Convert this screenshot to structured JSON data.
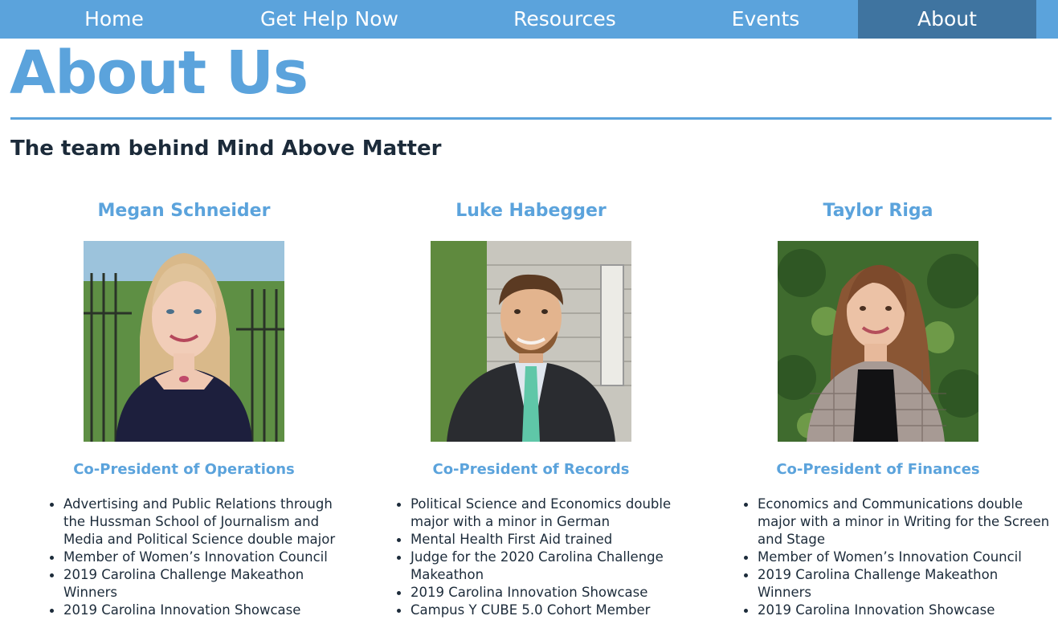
{
  "nav": {
    "items": [
      {
        "label": "Home"
      },
      {
        "label": "Get Help Now"
      },
      {
        "label": "Resources"
      },
      {
        "label": "Events"
      },
      {
        "label": "About"
      }
    ],
    "active": "About"
  },
  "page": {
    "title": "About Us",
    "subtitle": "The team behind Mind Above Matter"
  },
  "members": [
    {
      "name": "Megan Schneider",
      "role": "Co-President of Operations",
      "bullets": [
        "Advertising and Public Relations through the Hussman School of Journalism and Media and Political Science double major",
        "Member of Women’s Innovation Council",
        "2019 Carolina Challenge Makeathon Winners",
        "2019 Carolina Innovation Showcase"
      ]
    },
    {
      "name": "Luke Habegger",
      "role": "Co-President of Records",
      "bullets": [
        "Political Science and Economics double major with a minor in German",
        "Mental Health First Aid trained",
        "Judge for the 2020 Carolina Challenge Makeathon",
        "2019 Carolina Innovation Showcase",
        "Campus Y CUBE 5.0 Cohort Member"
      ]
    },
    {
      "name": "Taylor Riga",
      "role": "Co-President of Finances",
      "bullets": [
        "Economics and Communications double major with a minor in Writing for the Screen and Stage",
        "Member of Women’s Innovation Council",
        "2019 Carolina Challenge Makeathon Winners",
        "2019 Carolina Innovation Showcase"
      ]
    }
  ],
  "colors": {
    "accent": "#5ba3dc",
    "nav_active": "#3f74a0",
    "text": "#1c2b3a"
  }
}
